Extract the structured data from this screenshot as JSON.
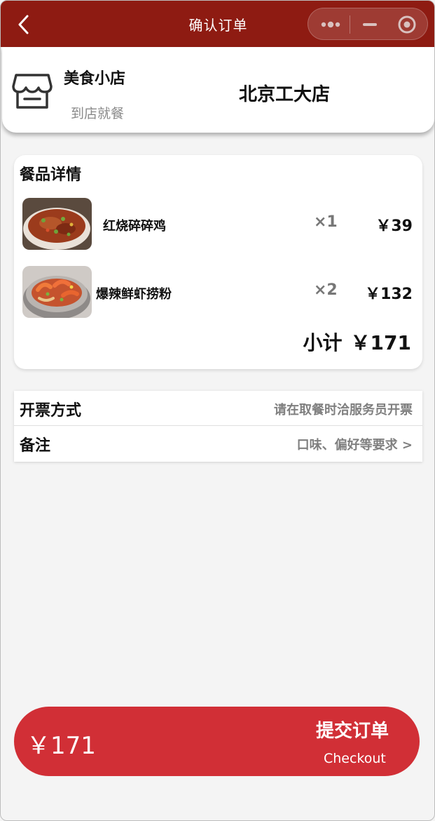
{
  "nav": {
    "title": "确认订单",
    "icons": {
      "back": "chevron-left-icon",
      "more": "more-dots-icon",
      "minimize": "minimize-icon",
      "close": "target-close-icon"
    }
  },
  "shop": {
    "name": "美食小店",
    "mode": "到店就餐",
    "branch": "北京工大店",
    "icon": "store-icon"
  },
  "details": {
    "title": "餐品详情",
    "items": [
      {
        "name": "红烧碎碎鸡",
        "qty": "×1",
        "price": "￥39",
        "thumb": "braised-chicken-photo"
      },
      {
        "name": "爆辣鲜虾捞粉",
        "qty": "×2",
        "price": "￥132",
        "thumb": "spicy-shrimp-noodle-photo"
      }
    ],
    "subtotal_label": "小计",
    "subtotal_value": "￥171"
  },
  "options": {
    "invoice_label": "开票方式",
    "invoice_value": "请在取餐时洽服务员开票",
    "remark_label": "备注",
    "remark_value": "口味、偏好等要求 >"
  },
  "checkout": {
    "total": "￥171",
    "submit_label": "提交订单",
    "submit_sublabel": "Checkout"
  },
  "colors": {
    "nav_bg": "#8e1b12",
    "checkout_bg": "#d12f36",
    "page_bg": "#f4f4f4"
  }
}
